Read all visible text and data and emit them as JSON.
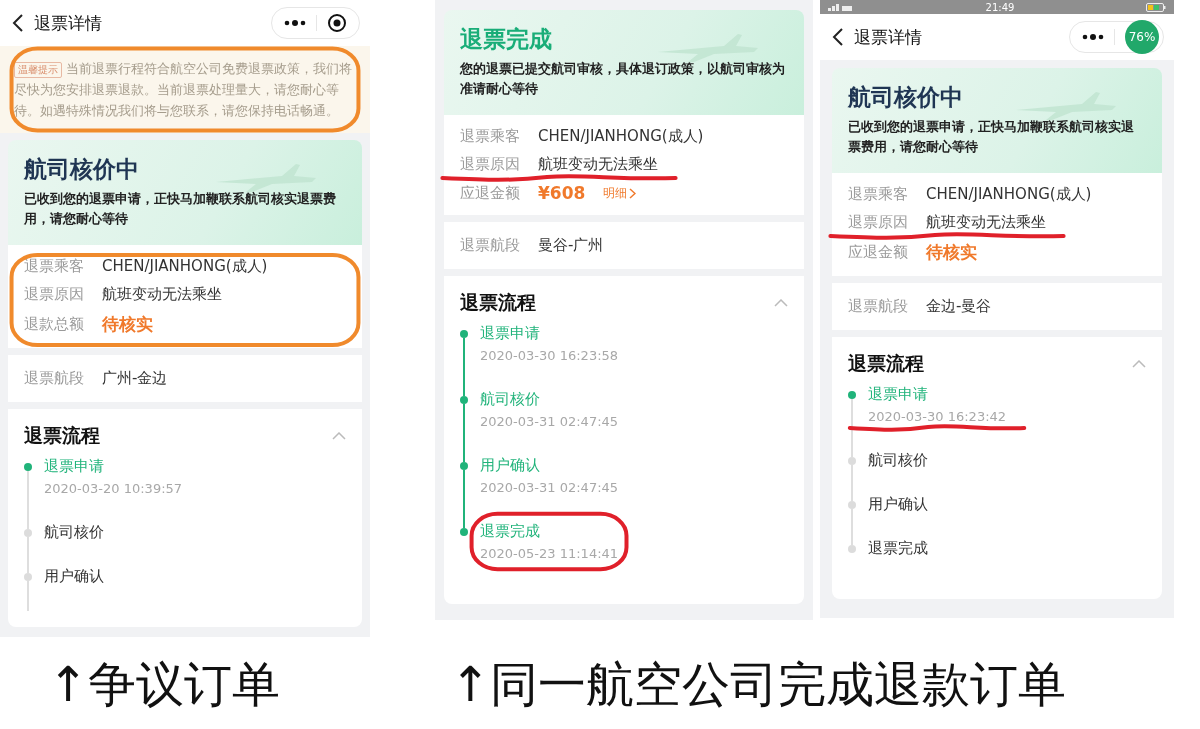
{
  "panels": [
    {
      "color": "#f08a2c",
      "nav": {
        "title": "退票详情"
      },
      "notice": {
        "tag": "温馨提示",
        "text": "当前退票行程符合航空公司免费退票政策，我们将尽快为您安排退票退款。当前退票处理量大，请您耐心等待。如遇特殊情况我们将与您联系，请您保持电话畅通。",
        "circled": true
      },
      "status": {
        "title": "航司核价中",
        "completed": false,
        "text": "已收到您的退票申请，正快马加鞭联系航司核实退票费用，请您耐心等待"
      },
      "info": {
        "circled": true,
        "rows": [
          {
            "kind": "text",
            "label": "退票乘客",
            "value": "CHEN/JIANHONG(成人)",
            "underlined": false
          },
          {
            "kind": "text",
            "label": "退票原因",
            "value": "航班变动无法乘坐",
            "underlined": false
          },
          {
            "kind": "amount",
            "label": "退款总额",
            "value": "待核实",
            "underlined": false
          }
        ]
      },
      "segment": {
        "label": "退票航段",
        "value": "广州-金边"
      },
      "process": {
        "title": "退票流程",
        "expanded": true,
        "steps": [
          {
            "name": "退票申请",
            "time": "2020-03-20 10:39:57",
            "done": true,
            "circled": false,
            "underlined": false
          },
          {
            "name": "航司核价",
            "done": false,
            "circled": false,
            "underlined": false
          },
          {
            "name": "用户确认",
            "done": false,
            "circled": false,
            "underlined": false
          }
        ]
      }
    },
    {
      "color": "#e0202a",
      "status": {
        "title": "退票完成",
        "completed": true,
        "text": "您的退票已提交航司审核，具体退订政策，以航司审核为准请耐心等待"
      },
      "info": {
        "circled": false,
        "rows": [
          {
            "kind": "text",
            "label": "退票乘客",
            "value": "CHEN/JIANHONG(成人)",
            "underlined": false
          },
          {
            "kind": "text",
            "label": "退票原因",
            "value": "航班变动无法乘坐",
            "underlined": true
          },
          {
            "kind": "amount",
            "label": "应退金额",
            "value": "¥608",
            "detail": "明细",
            "underlined": false
          }
        ]
      },
      "segment": {
        "label": "退票航段",
        "value": "曼谷-广州"
      },
      "process": {
        "title": "退票流程",
        "expanded": true,
        "steps": [
          {
            "name": "退票申请",
            "time": "2020-03-30 16:23:58",
            "done": true,
            "circled": false,
            "underlined": false
          },
          {
            "name": "航司核价",
            "time": "2020-03-31 02:47:45",
            "done": true,
            "circled": false,
            "underlined": false
          },
          {
            "name": "用户确认",
            "time": "2020-03-31 02:47:45",
            "done": true,
            "circled": false,
            "underlined": false
          },
          {
            "name": "退票完成",
            "time": "2020-05-23 11:14:41",
            "done": true,
            "circled": true,
            "underlined": false
          }
        ]
      }
    },
    {
      "color": "#e0202a",
      "phone_status": {
        "time": "21:49"
      },
      "nav": {
        "title": "退票详情",
        "badge": "76%"
      },
      "status": {
        "title": "航司核价中",
        "completed": false,
        "text": "已收到您的退票申请，正快马加鞭联系航司核实退票费用，请您耐心等待"
      },
      "info": {
        "circled": false,
        "rows": [
          {
            "kind": "text",
            "label": "退票乘客",
            "value": "CHEN/JIANHONG(成人)",
            "underlined": false
          },
          {
            "kind": "text",
            "label": "退票原因",
            "value": "航班变动无法乘坐",
            "underlined": true
          },
          {
            "kind": "amount",
            "label": "应退金额",
            "value": "待核实",
            "underlined": false
          }
        ]
      },
      "segment": {
        "label": "退票航段",
        "value": "金边-曼谷"
      },
      "process": {
        "title": "退票流程",
        "expanded": true,
        "steps": [
          {
            "name": "退票申请",
            "time": "2020-03-30 16:23:42",
            "done": true,
            "circled": false,
            "underlined": true
          },
          {
            "name": "航司核价",
            "done": false,
            "circled": false,
            "underlined": false
          },
          {
            "name": "用户确认",
            "done": false,
            "circled": false,
            "underlined": false
          },
          {
            "name": "退票完成",
            "done": false,
            "circled": false,
            "underlined": false
          }
        ]
      }
    }
  ],
  "captions": [
    "↑争议订单",
    "↑同一航空公司完成退款订单"
  ]
}
